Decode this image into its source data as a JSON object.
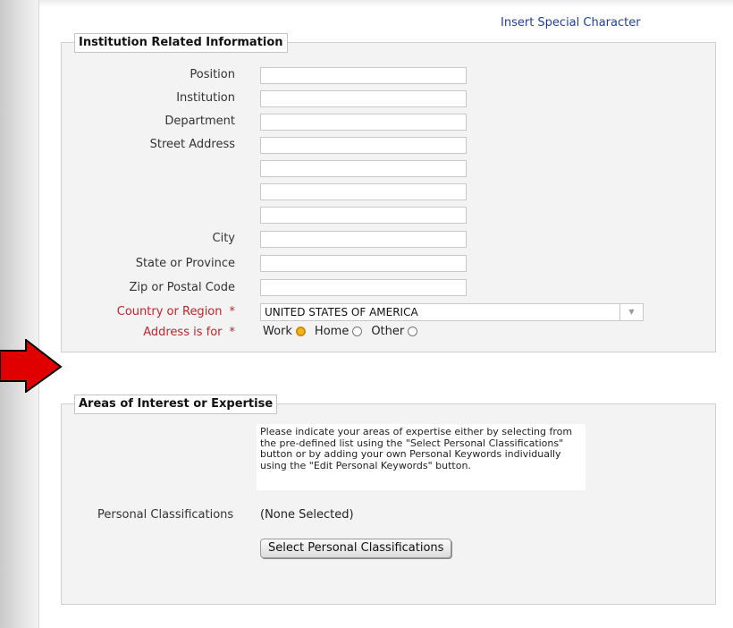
{
  "header": {
    "special_char_link": "Insert Special Character"
  },
  "institution": {
    "legend": "Institution Related Information",
    "labels": {
      "position": "Position",
      "institution": "Institution",
      "department": "Department",
      "street": "Street Address",
      "city": "City",
      "state": "State or Province",
      "zip": "Zip or Postal Code",
      "country": "Country or Region",
      "address_for": "Address is for"
    },
    "required_marker": "*",
    "country_value": "UNITED STATES OF AMERICA",
    "address_options": [
      {
        "label": "Work",
        "selected": true
      },
      {
        "label": "Home",
        "selected": false
      },
      {
        "label": "Other",
        "selected": false
      }
    ]
  },
  "interest": {
    "legend": "Areas of Interest or Expertise",
    "help_text": "Please indicate your areas of expertise either by selecting from the pre-defined list using the \"Select Personal Classifications\" button or by adding your own Personal Keywords individually using the \"Edit Personal Keywords\" button.",
    "classifications_label": "Personal Classifications",
    "classifications_value": "(None Selected)",
    "select_button": "Select Personal Classifications"
  },
  "colors": {
    "required": "#c0262c",
    "link": "#1f3f9a",
    "arrow": "#e00000"
  }
}
